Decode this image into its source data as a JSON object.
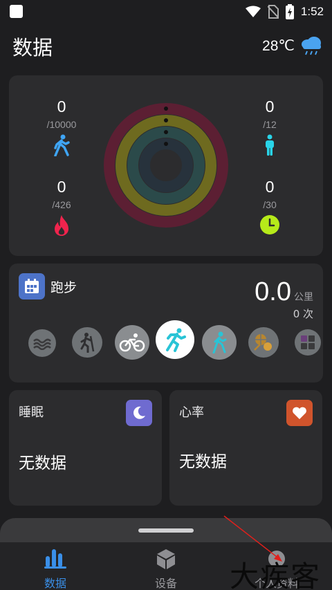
{
  "status_bar": {
    "time": "1:52"
  },
  "header": {
    "title": "数据",
    "temperature": "28℃",
    "weather_icon": "rain-cloud-icon"
  },
  "activity": {
    "steps": {
      "value": "0",
      "goal": "/10000",
      "icon": "walking-icon"
    },
    "calories": {
      "value": "0",
      "goal": "/426",
      "icon": "flame-icon"
    },
    "standing": {
      "value": "0",
      "goal": "/12",
      "icon": "standing-person-icon"
    },
    "exercise_minutes": {
      "value": "0",
      "goal": "/30",
      "icon": "clock-icon"
    },
    "ring_colors": [
      "#5c1f33",
      "#6e6a1f",
      "#2b4a4a",
      "#27323c"
    ]
  },
  "sport": {
    "name": "跑步",
    "distance": "0.0",
    "distance_unit": "公里",
    "count": "0 次",
    "types": [
      "swimming",
      "climbing",
      "cycling",
      "running",
      "walking",
      "ball-sports",
      "other"
    ],
    "selected": "running"
  },
  "sleep": {
    "title": "睡眠",
    "value": "无数据",
    "color": "#6f6bd0"
  },
  "heart_rate": {
    "title": "心率",
    "value": "无数据",
    "color": "#d0542c"
  },
  "nav": {
    "items": [
      {
        "label": "数据",
        "active": true
      },
      {
        "label": "设备",
        "active": false
      },
      {
        "label": "个人资料",
        "active": false
      }
    ],
    "accent": "#3a8fe8"
  },
  "watermark": "大疾客"
}
